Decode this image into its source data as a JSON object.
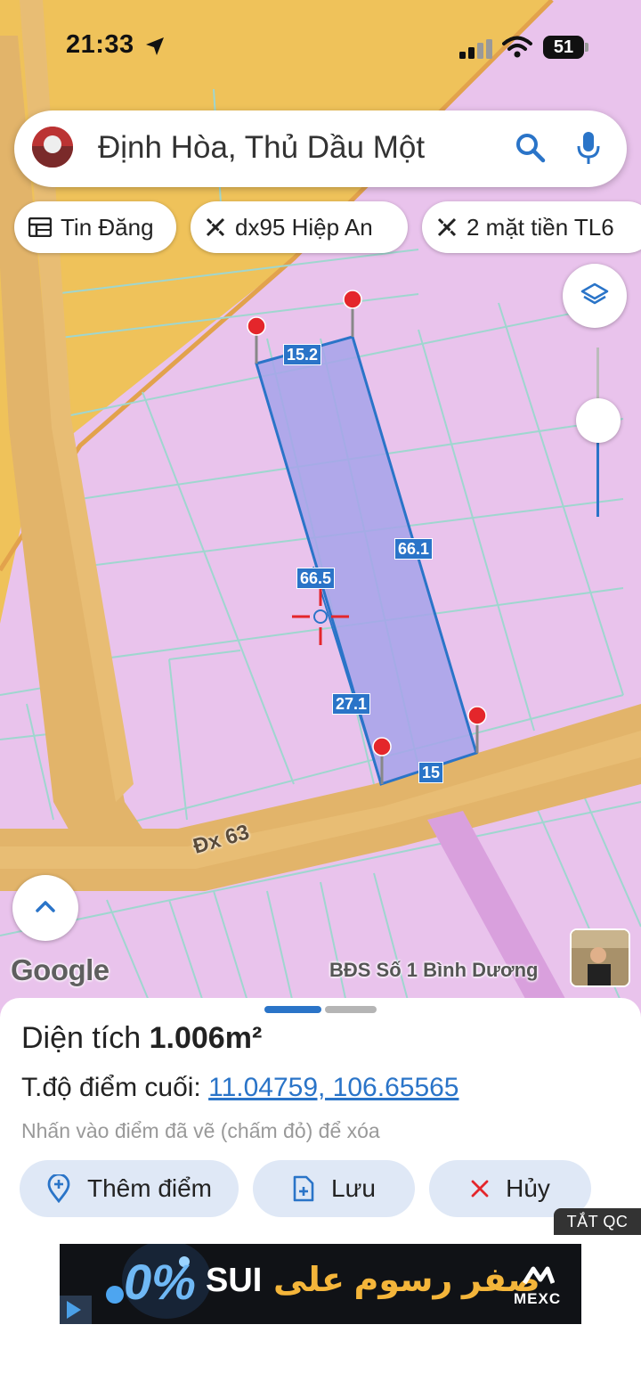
{
  "status_bar": {
    "time": "21:33",
    "battery": "51"
  },
  "search": {
    "query": "Định Hòa, Thủ Dầu Một"
  },
  "chips": [
    {
      "label": "Tin Đăng",
      "icon": "listing-icon"
    },
    {
      "label": "dx95 Hiệp An",
      "icon": "ruler-icon"
    },
    {
      "label": "2 mặt tiền TL6",
      "icon": "ruler-icon"
    }
  ],
  "map": {
    "measurements": [
      "15.2",
      "66.1",
      "66.5",
      "27.1",
      "15"
    ],
    "road_label": "Đx 63",
    "google_logo": "Google",
    "attribution": "BĐS Số 1 Bình Dương"
  },
  "sheet": {
    "area_prefix": "Diện tích ",
    "area_value": "1.006m²",
    "coord_label": "T.độ điểm cuối: ",
    "coord_value": "11.04759, 106.65565",
    "hint": "Nhấn vào điểm đã vẽ (chấm đỏ) để xóa",
    "buttons": {
      "add": "Thêm điểm",
      "save": "Lưu",
      "cancel": "Hủy"
    }
  },
  "ad": {
    "close_label": "TẮT QC",
    "brand": "SUI",
    "arabic_text": "صفر رسوم على",
    "advertiser": "MEXC",
    "percent": "0%"
  },
  "colors": {
    "accent": "#2a74c8",
    "plot_fill": "#a6a3ea",
    "land_pink": "#e9c3ec",
    "land_yellow": "#efc25a",
    "road": "#e2b46a",
    "marker_red": "#e4262b"
  }
}
